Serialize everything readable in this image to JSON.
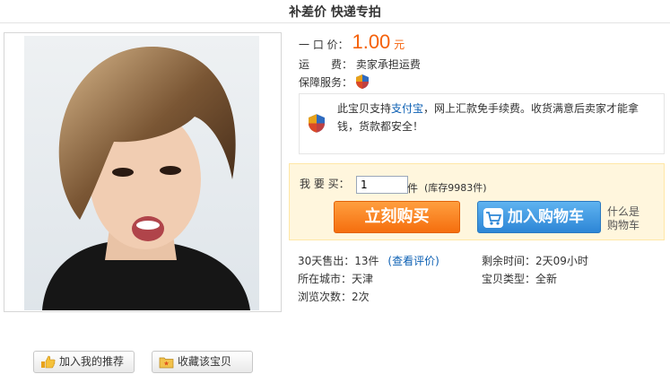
{
  "title": "补差价 快递专拍",
  "price": {
    "label": "一 口 价：",
    "value": "1.00",
    "unit": "元"
  },
  "shipping": {
    "label": "运　　费：",
    "value": "卖家承担运费"
  },
  "guarantee": {
    "label": "保障服务：",
    "icon": "shield-icon"
  },
  "notice": {
    "pre": "此宝贝支持",
    "link": "支付宝",
    "post": "，网上汇款免手续费。收货满意后卖家才能拿钱，货款都安全！"
  },
  "buy": {
    "qty_label": "我 要 买：",
    "qty_value": "1",
    "qty_unit": "件",
    "stock": "(库存9983件)",
    "buy_now": "立刻购买",
    "add_cart": "加入购物车",
    "whatis_line1": "什么是",
    "whatis_line2": "购物车"
  },
  "stats": {
    "sold_label": "30天售出：",
    "sold_value": "13件",
    "reviews_link": "(查看评价)",
    "remaining_label": "剩余时间：",
    "remaining_value": "2天09小时",
    "city_label": "所在城市：",
    "city_value": "天津",
    "type_label": "宝贝类型：",
    "type_value": "全新",
    "views_label": "浏览次数：",
    "views_value": "2次"
  },
  "actions": {
    "recommend": "加入我的推荐",
    "favorite": "收藏该宝贝"
  },
  "colors": {
    "price": "#f5610a",
    "buy_button": "#f56e0e",
    "cart_button": "#2d86d6",
    "link": "#0b5fb3",
    "buybox_bg": "#fff6dd"
  }
}
